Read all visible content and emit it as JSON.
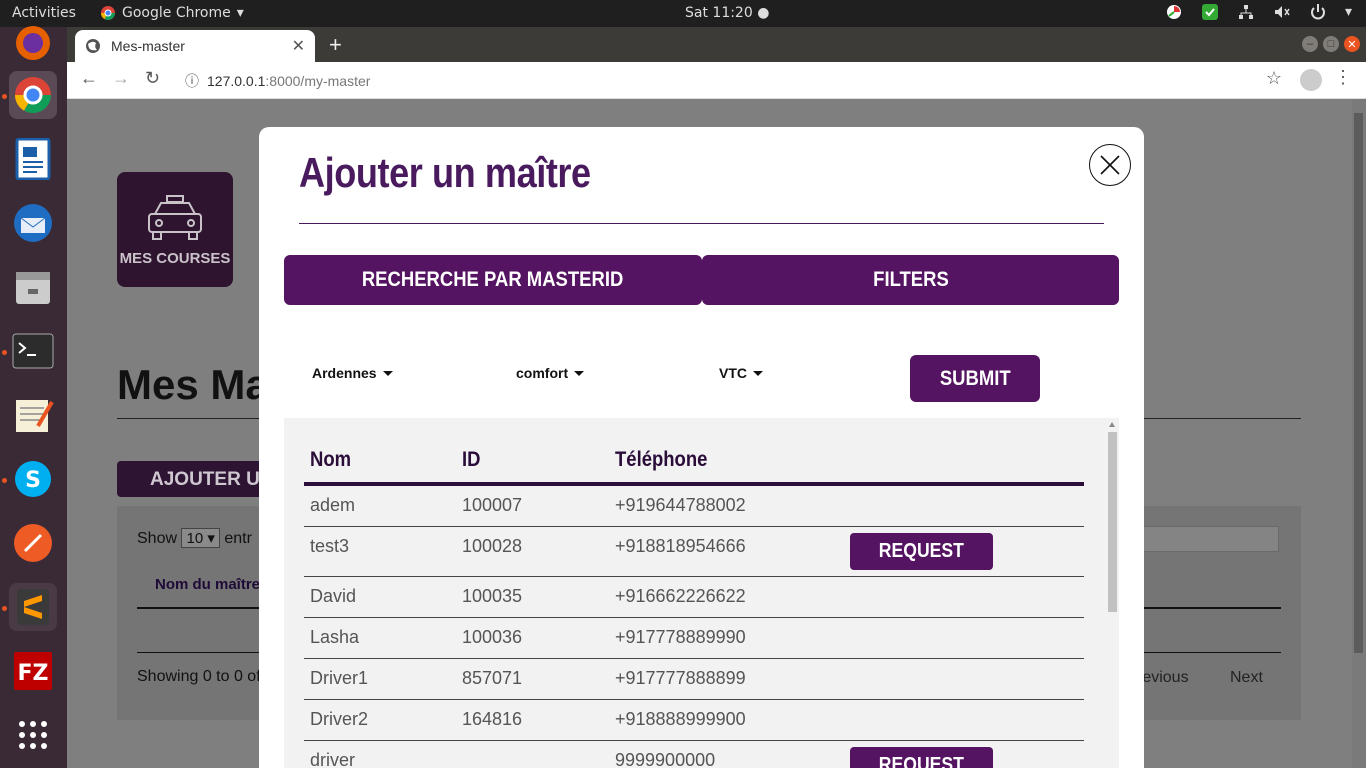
{
  "topbar": {
    "activities": "Activities",
    "app_name": "Google Chrome",
    "clock": "Sat 11:20"
  },
  "browser": {
    "tab_title": "Mes-master",
    "url_host": "127.0.0.1",
    "url_path": ":8000/my-master"
  },
  "background_page": {
    "courses_label": "MES COURSES",
    "title": "Mes Mas",
    "add_button": "AJOUTER UN",
    "show_label": "Show",
    "show_value": "10",
    "entries_label": "entr",
    "column_nom_maitre": "Nom du maître",
    "showing_text": "Showing 0 to 0 of",
    "previous": "revious",
    "next": "Next"
  },
  "modal": {
    "title": "Ajouter un maître",
    "tabs": {
      "by_masterid": "RECHERCHE PAR MASTERID",
      "filters": "FILTERS"
    },
    "filters": {
      "region": "Ardennes",
      "category": "comfort",
      "type": "VTC"
    },
    "submit_label": "SUBMIT",
    "table": {
      "headers": {
        "nom": "Nom",
        "id": "ID",
        "telephone": "Téléphone"
      },
      "request_label": "REQUEST",
      "rows": [
        {
          "nom": "adem",
          "id": "100007",
          "telephone": "+919644788002",
          "request": false
        },
        {
          "nom": "test3",
          "id": "100028",
          "telephone": "+918818954666",
          "request": true
        },
        {
          "nom": "David",
          "id": "100035",
          "telephone": "+916662226622",
          "request": false
        },
        {
          "nom": "Lasha",
          "id": "100036",
          "telephone": "+917778889990",
          "request": false
        },
        {
          "nom": "Driver1",
          "id": "857071",
          "telephone": "+917777888899",
          "request": false
        },
        {
          "nom": "Driver2",
          "id": "164816",
          "telephone": "+918888999900",
          "request": false
        },
        {
          "nom": "driver",
          "id": "",
          "telephone": "9999900000",
          "request": true
        }
      ]
    }
  },
  "colors": {
    "brand_purple": "#551461",
    "title_purple": "#4a1a5e",
    "header_dark": "#2b0d3a"
  }
}
